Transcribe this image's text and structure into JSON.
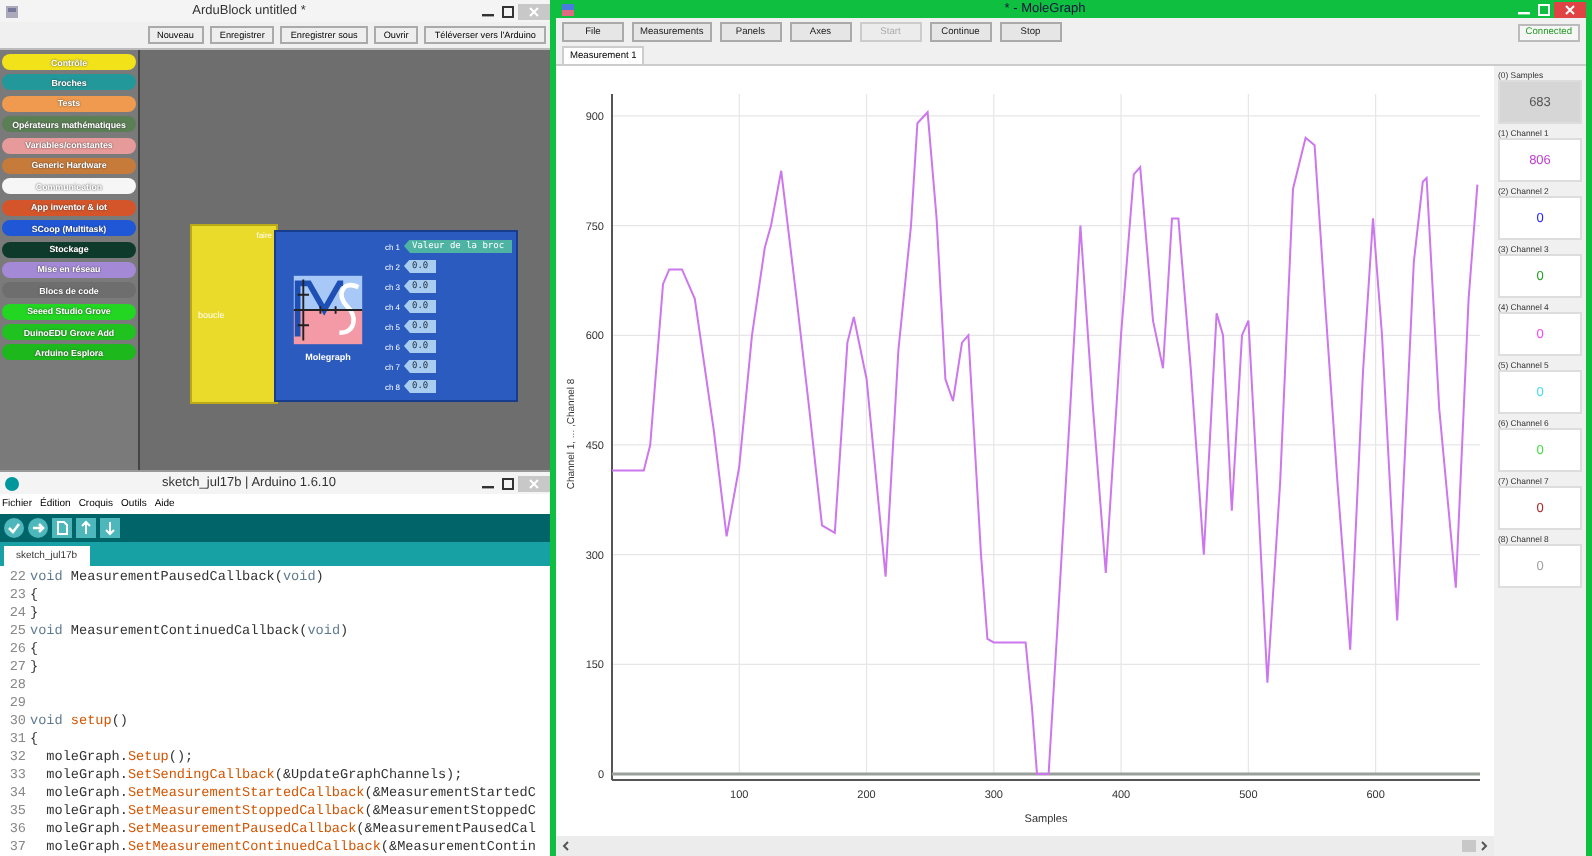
{
  "ardublock": {
    "title": "ArduBlock untitled *",
    "buttons": [
      "Nouveau",
      "Enregistrer",
      "Enregistrer sous",
      "Ouvrir",
      "Téléverser vers l'Arduino"
    ],
    "categories": [
      {
        "label": "Contrôle",
        "color": "#f2e21a"
      },
      {
        "label": "Broches",
        "color": "#23989a"
      },
      {
        "label": "Tests",
        "color": "#ef9a4e"
      },
      {
        "label": "Opérateurs mathématiques",
        "color": "#5b7f55"
      },
      {
        "label": "Variables/constantes",
        "color": "#e79a9a"
      },
      {
        "label": "Generic Hardware",
        "color": "#c77b3a"
      },
      {
        "label": "Communication",
        "color": "#f6f6f6"
      },
      {
        "label": "App inventor & iot",
        "color": "#d4552a"
      },
      {
        "label": "SCoop (Multitask)",
        "color": "#1f57d6"
      },
      {
        "label": "Stockage",
        "color": "#0e3a2c"
      },
      {
        "label": "Mise en réseau",
        "color": "#a48ad6"
      },
      {
        "label": "Blocs de code",
        "color": "#6e6e6e"
      },
      {
        "label": "Seeed Studio Grove",
        "color": "#22d622"
      },
      {
        "label": "DuinoEDU Grove Add",
        "color": "#1fc21f"
      },
      {
        "label": "Arduino Esplora",
        "color": "#1cb81c"
      }
    ],
    "loop_block": {
      "label": "boucle",
      "socket_label": "faire"
    },
    "molegraph_block": {
      "label": "Molegraph",
      "channels": [
        {
          "label": "ch 1",
          "value": "Valeur de la broc",
          "color": "#4eb3a3"
        },
        {
          "label": "ch 2",
          "value": "0.0",
          "color": "#a9cdf0"
        },
        {
          "label": "ch 3",
          "value": "0.0",
          "color": "#a9cdf0"
        },
        {
          "label": "ch 4",
          "value": "0.0",
          "color": "#a9cdf0"
        },
        {
          "label": "ch 5",
          "value": "0.0",
          "color": "#a9cdf0"
        },
        {
          "label": "ch 6",
          "value": "0.0",
          "color": "#a9cdf0"
        },
        {
          "label": "ch 7",
          "value": "0.0",
          "color": "#a9cdf0"
        },
        {
          "label": "ch 8",
          "value": "0.0",
          "color": "#a9cdf0"
        }
      ]
    }
  },
  "arduino": {
    "title": "sketch_jul17b | Arduino 1.6.10",
    "menu": [
      "Fichier",
      "Édition",
      "Croquis",
      "Outils",
      "Aide"
    ],
    "tab": "sketch_jul17b",
    "code": [
      {
        "number": "22",
        "tokens": [
          {
            "kind": "keyword",
            "text": "void"
          },
          {
            "kind": "plain",
            "text": " MeasurementPausedCallback("
          },
          {
            "kind": "keyword",
            "text": "void"
          },
          {
            "kind": "plain",
            "text": ")"
          }
        ]
      },
      {
        "number": "23",
        "tokens": [
          {
            "kind": "plain",
            "text": "{"
          }
        ]
      },
      {
        "number": "24",
        "tokens": [
          {
            "kind": "plain",
            "text": "}"
          }
        ]
      },
      {
        "number": "25",
        "tokens": [
          {
            "kind": "keyword",
            "text": "void"
          },
          {
            "kind": "plain",
            "text": " MeasurementContinuedCallback("
          },
          {
            "kind": "keyword",
            "text": "void"
          },
          {
            "kind": "plain",
            "text": ")"
          }
        ]
      },
      {
        "number": "26",
        "tokens": [
          {
            "kind": "plain",
            "text": "{"
          }
        ]
      },
      {
        "number": "27",
        "tokens": [
          {
            "kind": "plain",
            "text": "}"
          }
        ]
      },
      {
        "number": "28"
      },
      {
        "number": "29"
      },
      {
        "number": "30",
        "tokens": [
          {
            "kind": "keyword",
            "text": "void "
          },
          {
            "kind": "method",
            "text": "setup"
          },
          {
            "kind": "plain",
            "text": "()"
          }
        ]
      },
      {
        "number": "31",
        "tokens": [
          {
            "kind": "plain",
            "text": "{"
          }
        ]
      },
      {
        "number": "32",
        "tokens": [
          {
            "kind": "plain",
            "text": "  moleGraph."
          },
          {
            "kind": "method",
            "text": "Setup"
          },
          {
            "kind": "plain",
            "text": "();"
          }
        ]
      },
      {
        "number": "33",
        "tokens": [
          {
            "kind": "plain",
            "text": "  moleGraph."
          },
          {
            "kind": "method",
            "text": "SetSendingCallback"
          },
          {
            "kind": "plain",
            "text": "(&UpdateGraphChannels);"
          }
        ]
      },
      {
        "number": "34",
        "tokens": [
          {
            "kind": "plain",
            "text": "  moleGraph."
          },
          {
            "kind": "method",
            "text": "SetMeasurementStartedCallback"
          },
          {
            "kind": "plain",
            "text": "(&MeasurementStartedC"
          }
        ]
      },
      {
        "number": "35",
        "tokens": [
          {
            "kind": "plain",
            "text": "  moleGraph."
          },
          {
            "kind": "method",
            "text": "SetMeasurementStoppedCallback"
          },
          {
            "kind": "plain",
            "text": "(&MeasurementStoppedC"
          }
        ]
      },
      {
        "number": "36",
        "tokens": [
          {
            "kind": "plain",
            "text": "  moleGraph."
          },
          {
            "kind": "method",
            "text": "SetMeasurementPausedCallback"
          },
          {
            "kind": "plain",
            "text": "(&MeasurementPausedCal"
          }
        ]
      },
      {
        "number": "37",
        "tokens": [
          {
            "kind": "plain",
            "text": "  moleGraph."
          },
          {
            "kind": "method",
            "text": "SetMeasurementContinuedCallback"
          },
          {
            "kind": "plain",
            "text": "(&MeasurementContin"
          }
        ]
      }
    ]
  },
  "molegraph": {
    "title": "* - MoleGraph",
    "toolbar": [
      {
        "label": "File",
        "disabled": false
      },
      {
        "label": "Measurements",
        "disabled": false
      },
      {
        "label": "Panels",
        "disabled": false
      },
      {
        "label": "Axes",
        "disabled": false
      },
      {
        "label": "Start",
        "disabled": true
      },
      {
        "label": "Continue",
        "disabled": false
      },
      {
        "label": "Stop",
        "disabled": false
      }
    ],
    "status": "Connected",
    "tabs": [
      {
        "label": "Measurement 1",
        "selected": true
      }
    ],
    "chart_data": {
      "type": "line",
      "grid": true,
      "xlabel": "Samples",
      "ylabel": "Channel 1, ... ,Channel 8",
      "xlim": [
        0,
        682
      ],
      "ylim": [
        0,
        930
      ],
      "xticks": [
        100,
        200,
        300,
        400,
        500,
        600
      ],
      "yticks": [
        0,
        150,
        300,
        450,
        600,
        750,
        900
      ],
      "x": [
        0,
        25,
        30,
        40,
        45,
        55,
        65,
        80,
        90,
        100,
        110,
        120,
        125,
        133,
        145,
        155,
        165,
        175,
        185,
        190,
        200,
        215,
        225,
        235,
        240,
        248,
        255,
        262,
        268,
        275,
        280,
        290,
        295,
        300,
        325,
        330,
        334,
        343,
        350,
        360,
        368,
        378,
        388,
        400,
        410,
        415,
        425,
        433,
        440,
        445,
        455,
        465,
        475,
        480,
        487,
        495,
        500,
        507,
        515,
        525,
        535,
        545,
        552,
        560,
        570,
        580,
        590,
        598,
        605,
        617,
        630,
        637,
        640,
        650,
        663,
        673,
        680
      ],
      "series": [
        {
          "color": "#cc77ee",
          "values": [
            415,
            415,
            450,
            670,
            690,
            690,
            650,
            470,
            325,
            420,
            600,
            720,
            750,
            825,
            650,
            500,
            340,
            330,
            590,
            625,
            540,
            270,
            580,
            750,
            890,
            905,
            760,
            540,
            510,
            590,
            600,
            300,
            185,
            180,
            180,
            90,
            0,
            0,
            200,
            500,
            750,
            500,
            275,
            600,
            820,
            830,
            620,
            555,
            760,
            760,
            550,
            300,
            630,
            600,
            360,
            600,
            620,
            400,
            125,
            400,
            800,
            870,
            860,
            650,
            400,
            170,
            550,
            760,
            600,
            210,
            700,
            810,
            815,
            500,
            255,
            650,
            806
          ]
        }
      ]
    },
    "readouts": [
      {
        "label": "(0) Samples",
        "value": "683",
        "color": "#555555"
      },
      {
        "label": "(1) Channel 1",
        "value": "806",
        "color": "#c040d0"
      },
      {
        "label": "(2) Channel 2",
        "value": "0",
        "color": "#2020ff"
      },
      {
        "label": "(3) Channel 3",
        "value": "0",
        "color": "#20a020"
      },
      {
        "label": "(4) Channel 4",
        "value": "0",
        "color": "#ff40ff"
      },
      {
        "label": "(5) Channel 5",
        "value": "0",
        "color": "#40e0f0"
      },
      {
        "label": "(6) Channel 6",
        "value": "0",
        "color": "#40e040"
      },
      {
        "label": "(7) Channel 7",
        "value": "0",
        "color": "#b02020"
      },
      {
        "label": "(8) Channel 8",
        "value": "0",
        "color": "#a0a0a0"
      }
    ]
  }
}
